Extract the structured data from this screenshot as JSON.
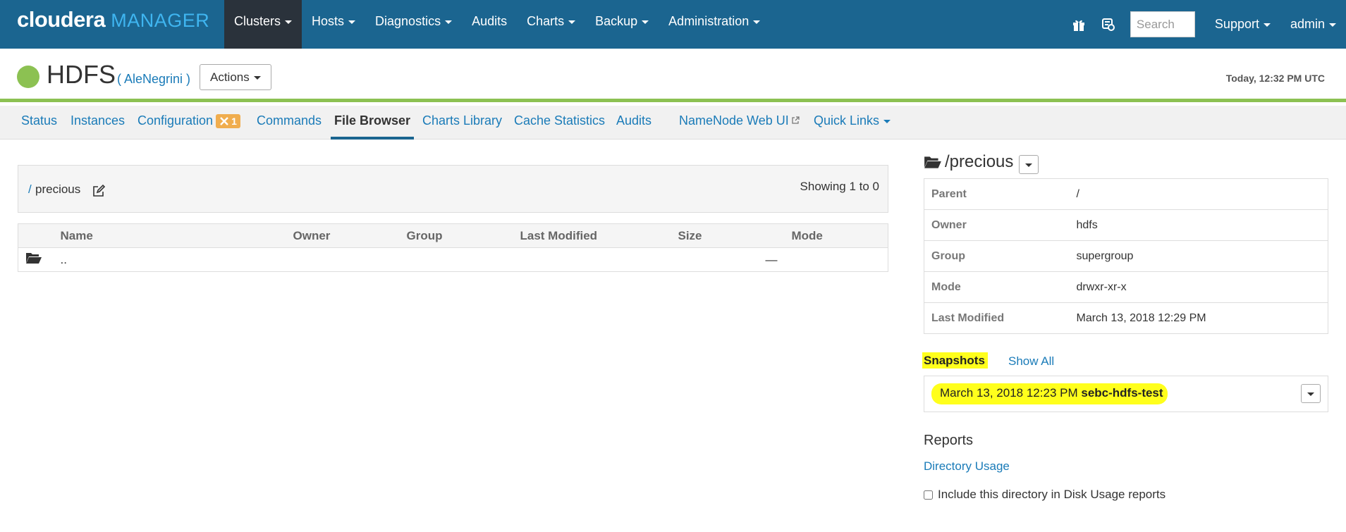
{
  "brand": {
    "name": "cloudera",
    "product": "MANAGER"
  },
  "topnav": {
    "items": [
      {
        "label": "Clusters",
        "dropdown": true,
        "active": true
      },
      {
        "label": "Hosts",
        "dropdown": true
      },
      {
        "label": "Diagnostics",
        "dropdown": true
      },
      {
        "label": "Audits",
        "dropdown": false
      },
      {
        "label": "Charts",
        "dropdown": true
      },
      {
        "label": "Backup",
        "dropdown": true
      },
      {
        "label": "Administration",
        "dropdown": true
      }
    ],
    "icons": [
      "gift-icon",
      "parcel-icon"
    ],
    "search_placeholder": "Search",
    "support_label": "Support",
    "user_label": "admin"
  },
  "service": {
    "name": "HDFS",
    "cluster": "( AleNegrini )",
    "actions_label": "Actions",
    "timestamp": "Today, 12:32 PM UTC",
    "status_color": "#8cc152"
  },
  "tabs": {
    "status": "Status",
    "instances": "Instances",
    "configuration": "Configuration",
    "config_badge": "1",
    "commands": "Commands",
    "file_browser": "File Browser",
    "charts_library": "Charts Library",
    "cache_statistics": "Cache Statistics",
    "audits": "Audits",
    "namenode_web_ui": "NameNode Web UI",
    "quick_links": "Quick Links"
  },
  "browser": {
    "path_root": "/",
    "path_dir": "precious",
    "showing": "Showing 1 to 0",
    "columns": [
      "Name",
      "Owner",
      "Group",
      "Last Modified",
      "Size",
      "Mode"
    ],
    "rows": [
      {
        "name": "..",
        "size_dash": "—"
      }
    ]
  },
  "details": {
    "title": "/precious",
    "properties": [
      {
        "key": "Parent",
        "value": "/"
      },
      {
        "key": "Owner",
        "value": "hdfs"
      },
      {
        "key": "Group",
        "value": "supergroup"
      },
      {
        "key": "Mode",
        "value": "drwxr-xr-x"
      },
      {
        "key": "Last Modified",
        "value": "March 13, 2018 12:29 PM"
      }
    ],
    "snapshots_label": "Snapshots",
    "show_all": "Show All",
    "snapshot": {
      "date": "March 13, 2018 12:23 PM",
      "name": "sebc-hdfs-test"
    },
    "reports_title": "Reports",
    "directory_usage": "Directory Usage",
    "include_label": "Include this directory in Disk Usage reports"
  },
  "colors": {
    "nav_bg": "#1b6590",
    "nav_active_bg": "#2a323b",
    "link": "#1a7bb8",
    "highlight": "#ffff1c",
    "badge": "#f0ad4e"
  }
}
